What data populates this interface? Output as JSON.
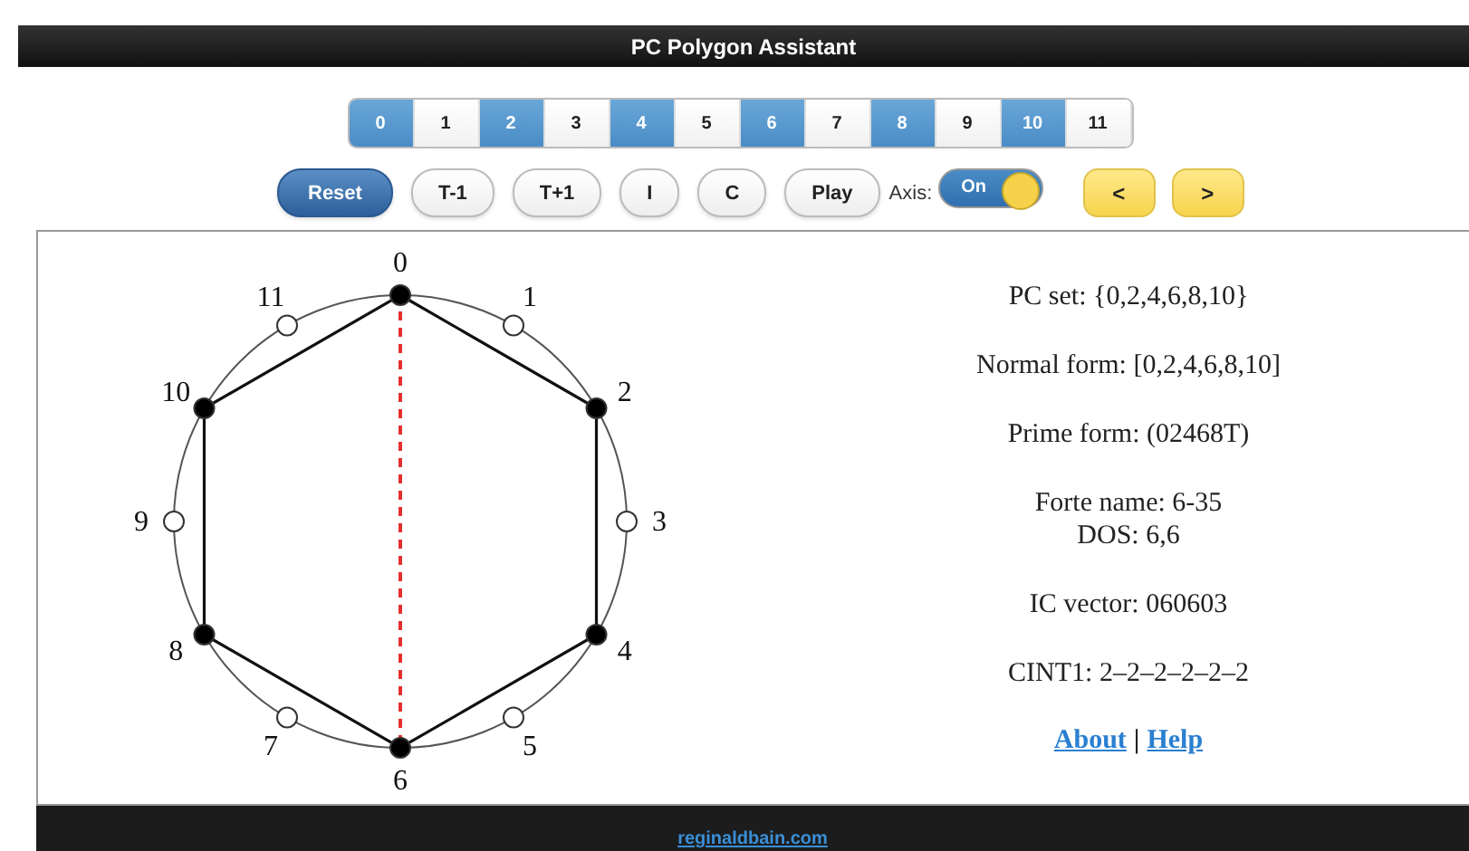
{
  "header": {
    "title": "PC Polygon Assistant"
  },
  "pitch_classes": [
    {
      "label": "0",
      "selected": true
    },
    {
      "label": "1",
      "selected": false
    },
    {
      "label": "2",
      "selected": true
    },
    {
      "label": "3",
      "selected": false
    },
    {
      "label": "4",
      "selected": true
    },
    {
      "label": "5",
      "selected": false
    },
    {
      "label": "6",
      "selected": true
    },
    {
      "label": "7",
      "selected": false
    },
    {
      "label": "8",
      "selected": true
    },
    {
      "label": "9",
      "selected": false
    },
    {
      "label": "10",
      "selected": true
    },
    {
      "label": "11",
      "selected": false
    }
  ],
  "buttons": [
    {
      "label": "Reset",
      "kind": "primary"
    },
    {
      "label": "T-1",
      "kind": "plain"
    },
    {
      "label": "T+1",
      "kind": "plain"
    },
    {
      "label": "I",
      "kind": "plain"
    },
    {
      "label": "C",
      "kind": "plain"
    },
    {
      "label": "Play",
      "kind": "plain"
    }
  ],
  "axis": {
    "label": "Axis:",
    "text": "On",
    "on": true
  },
  "nav_buttons": [
    {
      "label": "<"
    },
    {
      "label": ">"
    }
  ],
  "clock": {
    "points": [
      {
        "label": "0",
        "filled": true
      },
      {
        "label": "1",
        "filled": false
      },
      {
        "label": "2",
        "filled": true
      },
      {
        "label": "3",
        "filled": false
      },
      {
        "label": "4",
        "filled": true
      },
      {
        "label": "5",
        "filled": false
      },
      {
        "label": "6",
        "filled": true
      },
      {
        "label": "7",
        "filled": false
      },
      {
        "label": "8",
        "filled": true
      },
      {
        "label": "9",
        "filled": false
      },
      {
        "label": "10",
        "filled": true
      },
      {
        "label": "11",
        "filled": false
      }
    ]
  },
  "info": [
    [
      "PC set: {0,2,4,6,8,10}"
    ],
    [
      "Normal form: [0,2,4,6,8,10]"
    ],
    [
      "Prime form: (02468T)"
    ],
    [
      "Forte name: 6-35",
      "DOS: 6,6"
    ],
    [
      "IC vector: 060603"
    ],
    [
      "CINT1: 2–2–2–2–2–2"
    ]
  ],
  "links": [
    {
      "label": "About"
    },
    {
      "label": "Help"
    }
  ],
  "link_separator": "|",
  "footer": {
    "link": "reginaldbain.com"
  }
}
